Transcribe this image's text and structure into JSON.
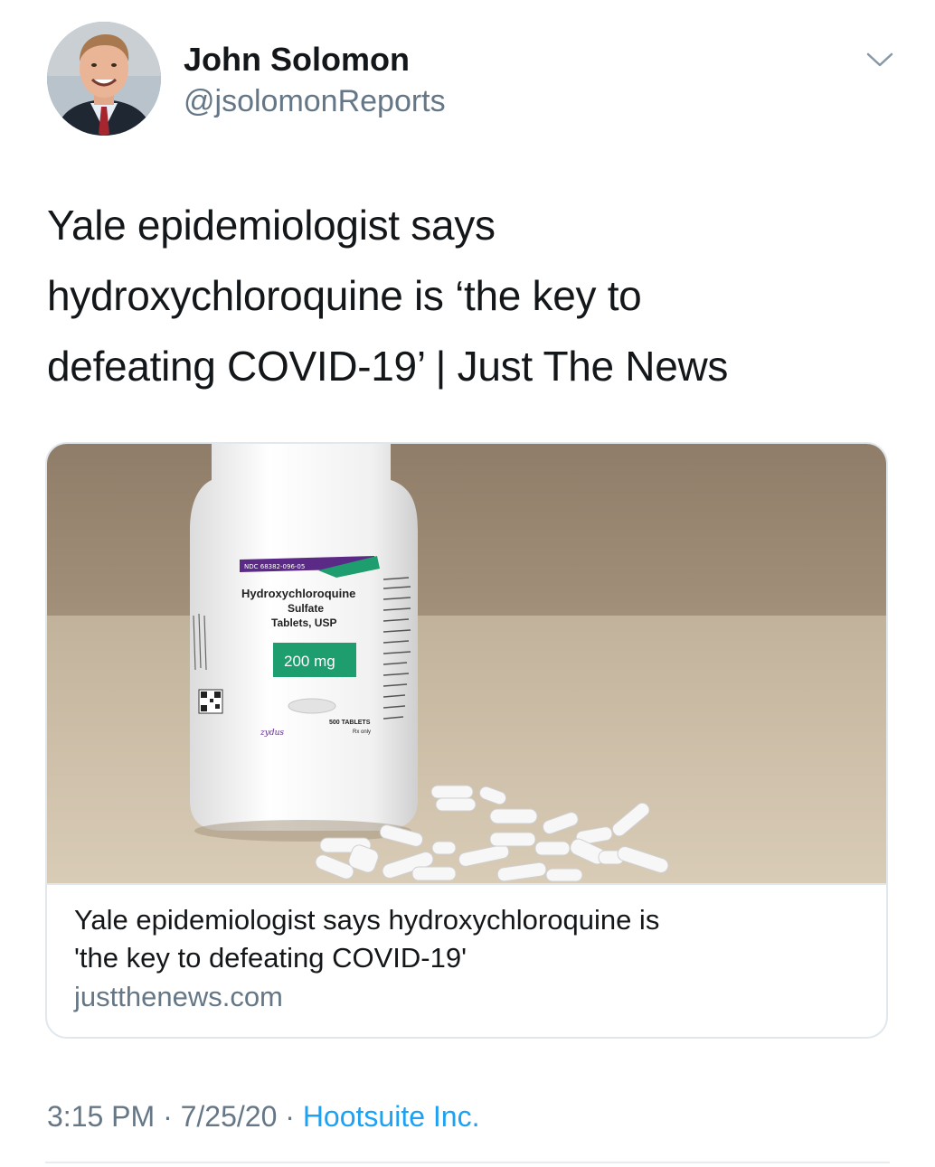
{
  "author": {
    "name": "John Solomon",
    "handle": "@jsolomonReports",
    "avatar_icon": "profile-photo"
  },
  "menu_icon": "chevron-down-icon",
  "tweet": {
    "text_lines": [
      "Yale epidemiologist says",
      "hydroxychloroquine is ‘the key to",
      "defeating COVID-19’ | Just The News"
    ]
  },
  "card": {
    "image": {
      "label_ndc": "NDC 68382-096-05",
      "label_drug": "Hydroxychloroquine",
      "label_salt": "Sulfate",
      "label_form": "Tablets, USP",
      "label_dose": "200 mg",
      "label_count": "500 TABLETS",
      "label_rx": "Rx only",
      "label_brand": "zydus"
    },
    "title_lines": [
      "Yale epidemiologist says hydroxychloroquine is",
      "'the key to defeating COVID-19'"
    ],
    "domain": "justthenews.com"
  },
  "meta": {
    "time": "3:15 PM",
    "separator": "·",
    "date": "7/25/20",
    "source": "Hootsuite Inc."
  },
  "colors": {
    "text": "#14171a",
    "secondary": "#657786",
    "link": "#1da1f2",
    "border": "#e1e8ed",
    "label_purple": "#5b2a86",
    "label_green": "#1e9d6e"
  }
}
